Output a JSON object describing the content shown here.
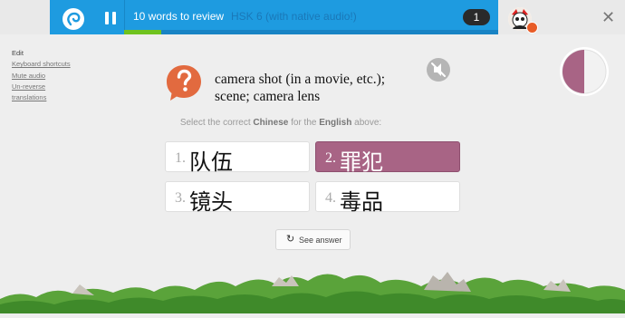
{
  "header": {
    "review_title": "10 words to review",
    "course_name": "HSK 6 (with native audio!)",
    "remaining_count": "1",
    "progress_fraction": 0.1,
    "accent_color": "#1e9be0",
    "progress_color": "#6fc21e"
  },
  "sidebar": {
    "edit": "Edit",
    "links": [
      "Keyboard shortcuts",
      "Mute audio",
      "Un-reverse",
      "translations"
    ]
  },
  "question": {
    "prompt_line1": "camera shot (in a movie, etc.);",
    "prompt_line2": "scene; camera lens",
    "instruction_pre": "Select the correct ",
    "instruction_target": "Chinese",
    "instruction_mid": " for the ",
    "instruction_source": "English",
    "instruction_post": " above:"
  },
  "choices": [
    {
      "num": "1.",
      "text": "队伍",
      "selected": false
    },
    {
      "num": "2.",
      "text": "罪犯",
      "selected": true
    },
    {
      "num": "3.",
      "text": "镜头",
      "selected": false
    },
    {
      "num": "4.",
      "text": "毒品",
      "selected": false
    }
  ],
  "actions": {
    "see_answer": "See answer"
  },
  "timer": {
    "remaining_fraction": 0.5,
    "color": "#a86485"
  },
  "icons": {
    "logo": "memrise-logo-icon",
    "pause": "pause-icon",
    "question": "question-mark-icon",
    "mute": "mute-audio-icon",
    "refresh": "refresh-icon",
    "close": "close-icon"
  }
}
